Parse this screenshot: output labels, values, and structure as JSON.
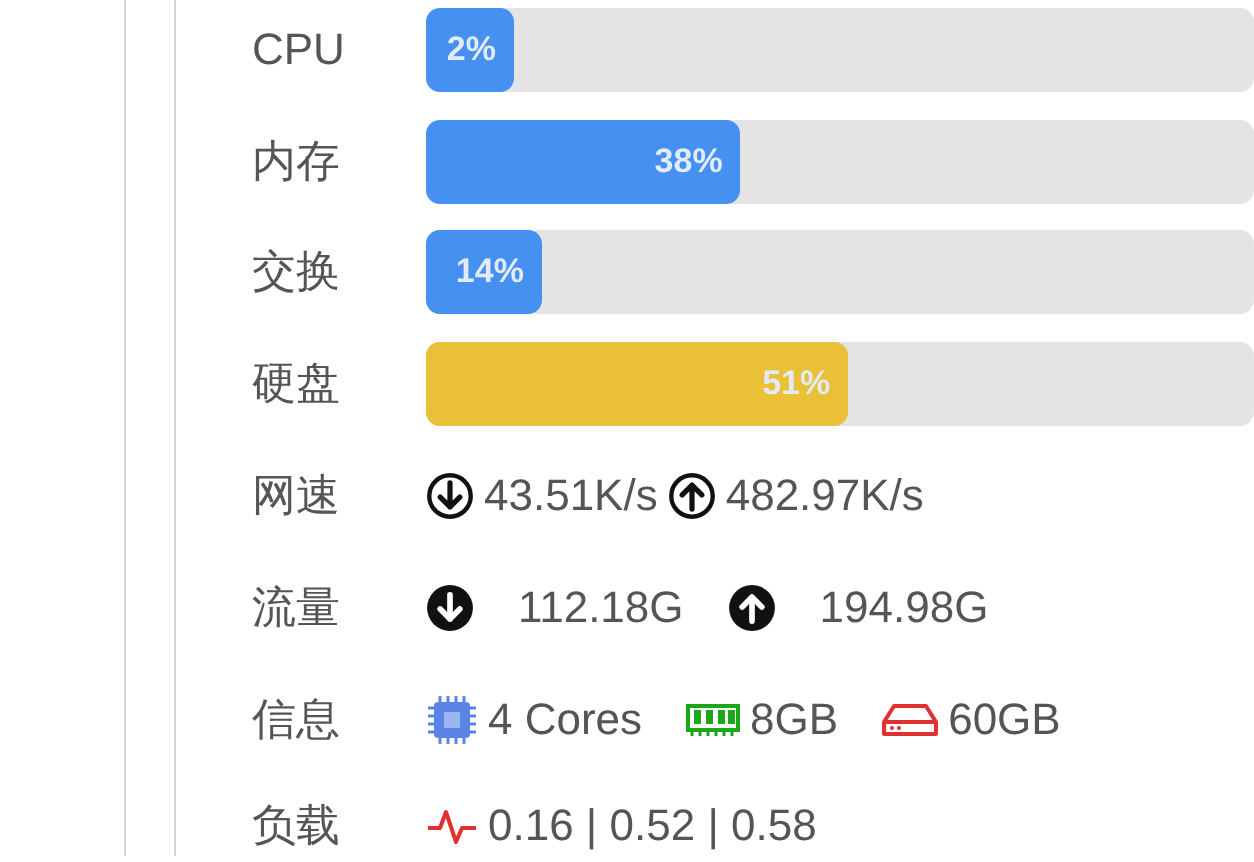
{
  "bars": [
    {
      "label": "CPU",
      "level": 0.02,
      "reading": "2%",
      "color": "#4590f0"
    },
    {
      "label": "内存",
      "level": 0.38,
      "reading": "38%",
      "color": "#4590f0"
    },
    {
      "label": "交换",
      "level": 0.14,
      "reading": "14%",
      "color": "#4590f0"
    },
    {
      "label": "硬盘",
      "level": 0.51,
      "reading": "51%",
      "color": "#e9c036"
    }
  ],
  "network_speed": {
    "label": "网速",
    "download": "43.51K/s",
    "upload": "482.97K/s"
  },
  "traffic": {
    "label": "流量",
    "download": "112.18G",
    "upload": "194.98G"
  },
  "info": {
    "label": "信息",
    "cpu": "4 Cores",
    "memory": "8GB",
    "disk": "60GB"
  },
  "load": {
    "label": "负载",
    "value": "0.16 | 0.52 | 0.58"
  }
}
